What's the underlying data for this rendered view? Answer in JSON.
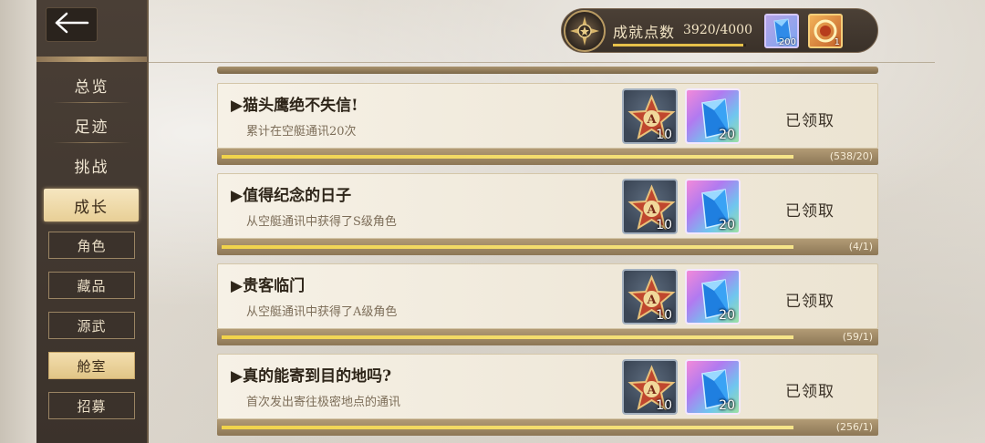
{
  "sidebar": {
    "main_items": [
      {
        "label": "总览"
      },
      {
        "label": "足迹"
      },
      {
        "label": "挑战"
      },
      {
        "label": "成长",
        "active": true
      }
    ],
    "sub_items": [
      {
        "label": "角色"
      },
      {
        "label": "藏品"
      },
      {
        "label": "源武"
      },
      {
        "label": "舱室",
        "active": true
      },
      {
        "label": "招募"
      }
    ]
  },
  "achievement": {
    "label": "成就点数",
    "value": "3920/4000",
    "progress": 0.98,
    "rewards": [
      {
        "icon": "blue-crystal-icon",
        "count": "200"
      },
      {
        "icon": "gold-medal-icon",
        "count": "1"
      }
    ]
  },
  "cards": [
    {
      "title": "▶猫头鹰绝不失信!",
      "desc": "累计在空艇通讯20次",
      "rewards": [
        {
          "icon": "star-a-badge-icon",
          "qty": "10"
        },
        {
          "icon": "crystal-gem-icon",
          "qty": "20"
        }
      ],
      "status": "已领取",
      "progress_text": "(538/20)",
      "progress": 1.0
    },
    {
      "title": "▶值得纪念的日子",
      "desc": "从空艇通讯中获得了S级角色",
      "rewards": [
        {
          "icon": "star-a-badge-icon",
          "qty": "10"
        },
        {
          "icon": "crystal-gem-icon",
          "qty": "20"
        }
      ],
      "status": "已领取",
      "progress_text": "(4/1)",
      "progress": 1.0
    },
    {
      "title": "▶贵客临门",
      "desc": "从空艇通讯中获得了A级角色",
      "rewards": [
        {
          "icon": "star-a-badge-icon",
          "qty": "10"
        },
        {
          "icon": "crystal-gem-icon",
          "qty": "20"
        }
      ],
      "status": "已领取",
      "progress_text": "(59/1)",
      "progress": 1.0
    },
    {
      "title": "▶真的能寄到目的地吗?",
      "desc": "首次发出寄往极密地点的通讯",
      "rewards": [
        {
          "icon": "star-a-badge-icon",
          "qty": "10"
        },
        {
          "icon": "crystal-gem-icon",
          "qty": "20"
        }
      ],
      "status": "已领取",
      "progress_text": "(256/1)",
      "progress": 1.0
    }
  ],
  "colors": {
    "sidebar_bg": "#3b322b",
    "active_tab": "#e8cf96",
    "progress_fill": "#f1d34a"
  }
}
